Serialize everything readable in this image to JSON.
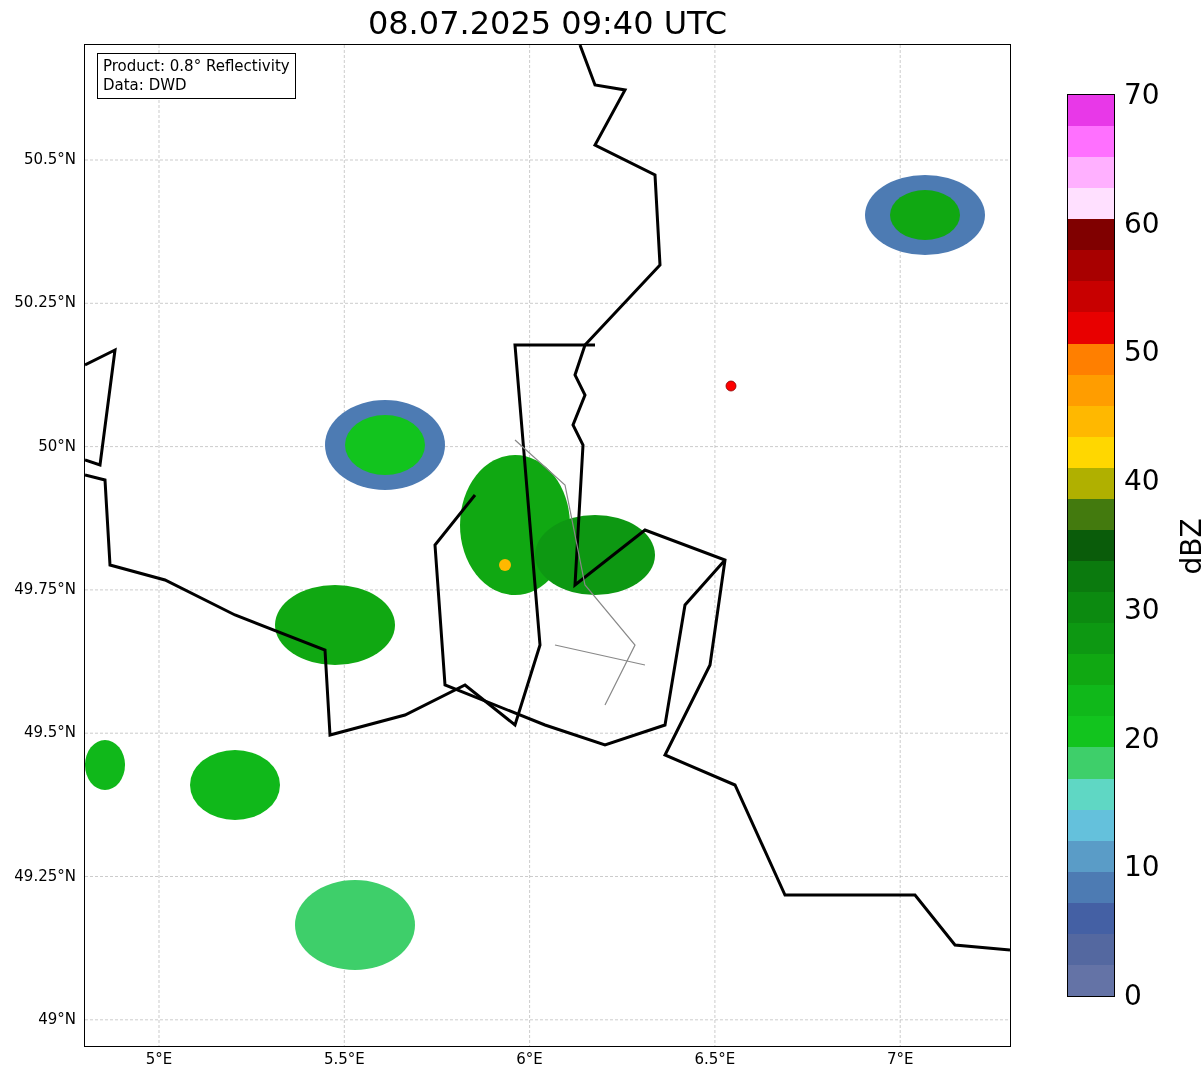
{
  "title": "08.07.2025 09:40 UTC",
  "info_box": {
    "lines": [
      "Product: 0.8° Reflectivity",
      "Data: DWD"
    ]
  },
  "map": {
    "y_ticks": [
      "50.5°N",
      "50.25°N",
      "50°N",
      "49.75°N",
      "49.5°N",
      "49.25°N",
      "49°N"
    ],
    "x_ticks": [
      "5°E",
      "5.5°E",
      "6°E",
      "6.5°E",
      "7°E"
    ]
  },
  "colorbar": {
    "label": "dBZ",
    "ticks": [
      "70",
      "60",
      "50",
      "40",
      "30",
      "20",
      "10",
      "0"
    ],
    "bands": [
      {
        "color": "#e838e8"
      },
      {
        "color": "#ff70ff"
      },
      {
        "color": "#ffb0ff"
      },
      {
        "color": "#ffe0ff"
      },
      {
        "color": "#800000"
      },
      {
        "color": "#a80000"
      },
      {
        "color": "#c80000"
      },
      {
        "color": "#e80000"
      },
      {
        "color": "#ff7f00"
      },
      {
        "color": "#ff9d00"
      },
      {
        "color": "#ffb800"
      },
      {
        "color": "#ffd700"
      },
      {
        "color": "#b0b000"
      },
      {
        "color": "#437a0e"
      },
      {
        "color": "#0a5c0a"
      },
      {
        "color": "#0b7a0e"
      },
      {
        "color": "#0c8a10"
      },
      {
        "color": "#0d9812"
      },
      {
        "color": "#10a812"
      },
      {
        "color": "#10b81a"
      },
      {
        "color": "#12c41e"
      },
      {
        "color": "#3ecf6a"
      },
      {
        "color": "#5fd7c4"
      },
      {
        "color": "#64c1dc"
      },
      {
        "color": "#5a9cc7"
      },
      {
        "color": "#4d7bb3"
      },
      {
        "color": "#4460a4"
      },
      {
        "color": "#5468a0"
      },
      {
        "color": "#6473a6"
      }
    ]
  }
}
